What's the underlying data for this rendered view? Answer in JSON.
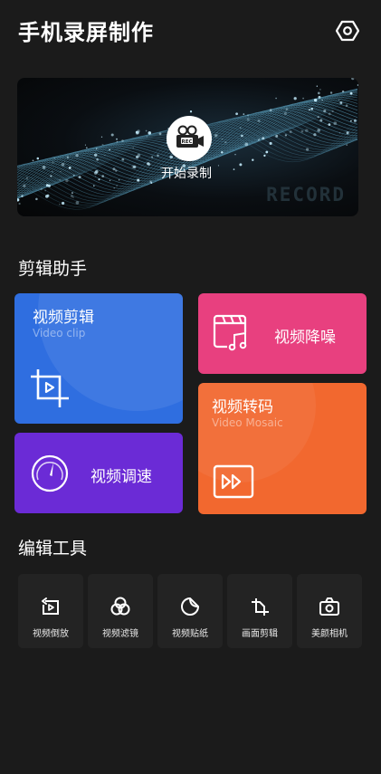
{
  "header": {
    "title": "手机录屏制作",
    "settings_icon": "settings-hexagon-icon"
  },
  "banner": {
    "start_label": "开始录制",
    "watermark": "RECORD",
    "icon": "video-camera-rec-icon"
  },
  "sections": {
    "assistant": "剪辑助手",
    "tools": "编辑工具"
  },
  "cards": {
    "clip": {
      "title": "视频剪辑",
      "subtitle": "Video clip",
      "icon": "crop-icon",
      "color": "#2f6ee0"
    },
    "noise": {
      "title": "视频降噪",
      "icon": "film-music-icon",
      "color": "#e8407f"
    },
    "speed": {
      "title": "视频调速",
      "icon": "speedometer-icon",
      "color": "#6b2bd6"
    },
    "mosaic": {
      "title": "视频转码",
      "subtitle": "Video Mosaic",
      "icon": "fast-forward-icon",
      "color": "#f2682f"
    }
  },
  "tools": [
    {
      "label": "视频倒放",
      "icon": "reverse-play-icon"
    },
    {
      "label": "视频滤镜",
      "icon": "filter-circles-icon"
    },
    {
      "label": "视频贴纸",
      "icon": "sticker-icon"
    },
    {
      "label": "画面剪辑",
      "icon": "canvas-crop-icon"
    },
    {
      "label": "美颜相机",
      "icon": "camera-icon"
    }
  ]
}
